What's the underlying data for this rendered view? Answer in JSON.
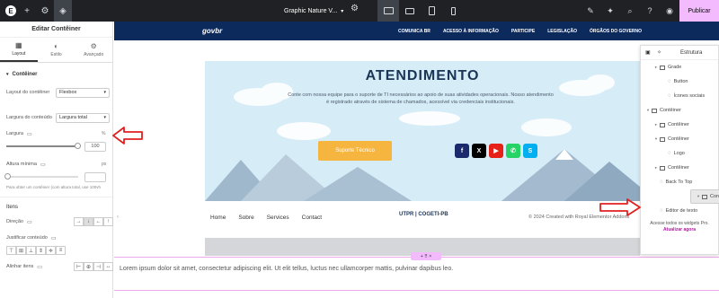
{
  "topbar": {
    "doc_title": "Graphic Nature V...",
    "publish_label": "Publicar"
  },
  "left_panel": {
    "title": "Editar Contêiner",
    "tabs": [
      {
        "label": "Layout",
        "icon": "layout-icon",
        "active": true
      },
      {
        "label": "Estilo",
        "icon": "style-icon",
        "active": false
      },
      {
        "label": "Avançado",
        "icon": "gear-icon",
        "active": false
      }
    ],
    "section_container": "Contêiner",
    "layout_label": "Layout do contêiner",
    "layout_value": "Flexbox",
    "width_label": "Largura do conteúdo",
    "width_value": "Largura total",
    "largura_label": "Largura",
    "largura_unit": "%",
    "largura_value": "100",
    "largura_fill": 1.0,
    "altura_label": "Altura mínima",
    "altura_unit": "px",
    "altura_value": "",
    "note": "Para obter um contêiner (com altura total, use 100vh",
    "section_items": "Itens",
    "direcao_label": "Direção",
    "justificar_label": "Justificar conteúdo",
    "alinhar_label": "Alinhar itens"
  },
  "canvas": {
    "gov_logo": "govbr",
    "gov_nav": [
      "COMUNICA BR",
      "ACESSO À INFORMAÇÃO",
      "PARTICIPE",
      "LEGISLAÇÃO",
      "ÓRGÃOS DO GOVERNO"
    ],
    "hero_title": "ATENDIMENTO",
    "hero_text": "Conte com nossa equipe para o suporte de TI necessários ao apoio de suas atividades operacionais. Nosso atendimento é registrado através de sistema de chamados, acessível via credenciais institucionais.",
    "support_button": "Suporte Técnico",
    "footer_nav": [
      "Home",
      "Sobre",
      "Services",
      "Contact"
    ],
    "footer_logo": "UTPR | COGETI-PB",
    "footer_copy": "© 2024 Created with Royal Elementor Addons",
    "lorem": "Lorem ipsum dolor sit amet, consectetur adipiscing elit. Ut elit tellus, luctus nec ullamcorper mattis, pulvinar dapibus leo.",
    "pink_tag": "+ ⠿ ×"
  },
  "navigator": {
    "title": "Estrutura",
    "items": [
      {
        "label": "Grade",
        "level": 1,
        "arrow": "▸",
        "type": "grid"
      },
      {
        "label": "Button",
        "level": 2,
        "arrow": "",
        "type": "widget"
      },
      {
        "label": "Ícones sociais",
        "level": 2,
        "arrow": "",
        "type": "widget"
      },
      {
        "label": "Contêiner",
        "level": 0,
        "arrow": "▾",
        "type": "container"
      },
      {
        "label": "Contêiner",
        "level": 1,
        "arrow": "▸",
        "type": "container"
      },
      {
        "label": "Contêiner",
        "level": 1,
        "arrow": "▾",
        "type": "container"
      },
      {
        "label": "Logo",
        "level": 2,
        "arrow": "",
        "type": "widget"
      },
      {
        "label": "Contêiner",
        "level": 1,
        "arrow": "▸",
        "type": "container"
      },
      {
        "label": "Back To Top",
        "level": 1,
        "arrow": "",
        "type": "widget"
      },
      {
        "label": "Contêiner",
        "level": 0,
        "arrow": "▾",
        "type": "container",
        "selected": true
      },
      {
        "label": "Editor de texto",
        "level": 1,
        "arrow": "",
        "type": "widget"
      }
    ],
    "promo_text": "Acesse todos os widgets Pro.",
    "promo_link": "Atualizar agora"
  },
  "colors": {
    "topbar": "#1f2124",
    "gov_bar": "#0d2a5c",
    "publish": "#f3bafd",
    "support_button": "#f5b53f",
    "annotation_arrow": "#e02020"
  }
}
